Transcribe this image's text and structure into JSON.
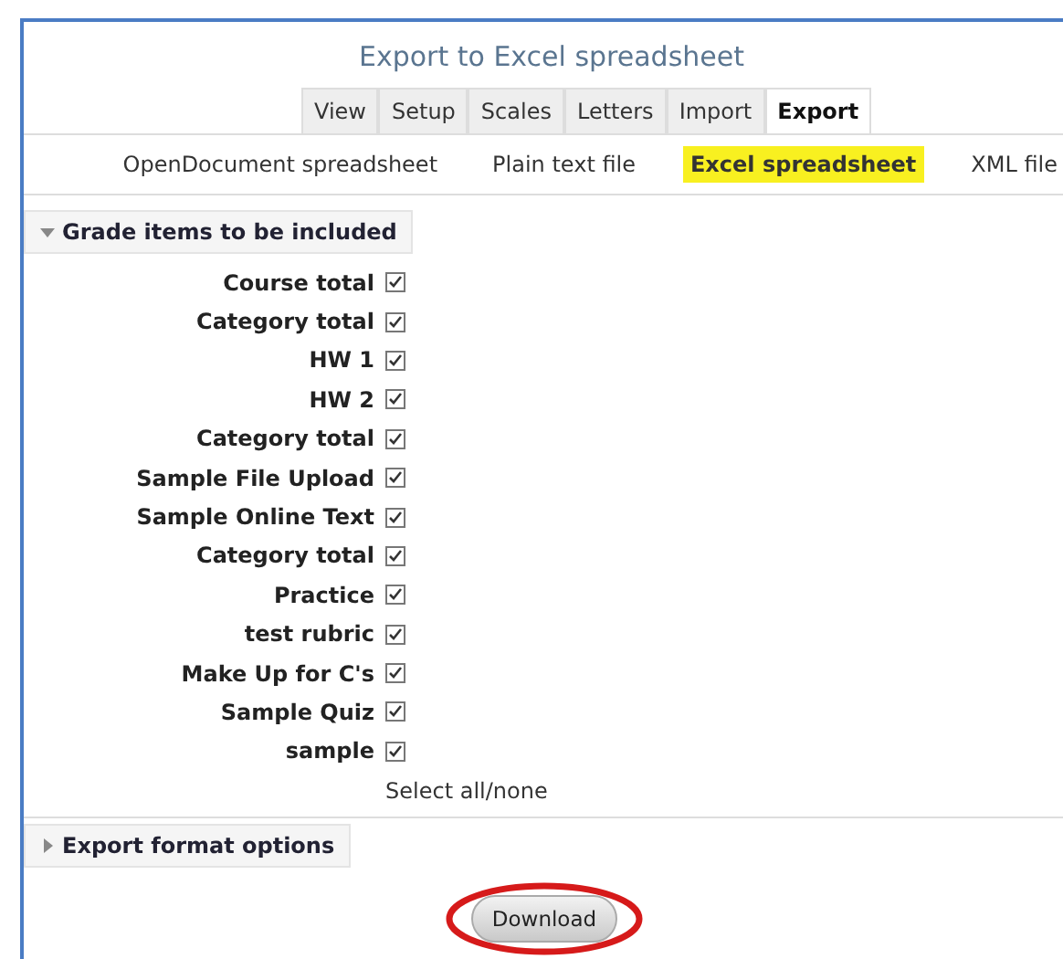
{
  "title": "Export to Excel spreadsheet",
  "tabs": [
    {
      "label": "View",
      "selected": false
    },
    {
      "label": "Setup",
      "selected": false
    },
    {
      "label": "Scales",
      "selected": false
    },
    {
      "label": "Letters",
      "selected": false
    },
    {
      "label": "Import",
      "selected": false
    },
    {
      "label": "Export",
      "selected": true
    }
  ],
  "subtabs": [
    {
      "label": "OpenDocument spreadsheet",
      "selected": false
    },
    {
      "label": "Plain text file",
      "selected": false
    },
    {
      "label": "Excel spreadsheet",
      "selected": true
    },
    {
      "label": "XML file",
      "selected": false
    }
  ],
  "grade_section": {
    "title": "Grade items to be included",
    "expanded": true,
    "items": [
      {
        "label": "Course total",
        "checked": true
      },
      {
        "label": "Category total",
        "checked": true
      },
      {
        "label": "HW 1",
        "checked": true
      },
      {
        "label": "HW 2",
        "checked": true
      },
      {
        "label": "Category total",
        "checked": true
      },
      {
        "label": "Sample File Upload",
        "checked": true
      },
      {
        "label": "Sample Online Text",
        "checked": true
      },
      {
        "label": "Category total",
        "checked": true
      },
      {
        "label": "Practice",
        "checked": true
      },
      {
        "label": "test rubric",
        "checked": true
      },
      {
        "label": "Make Up for C's",
        "checked": true
      },
      {
        "label": "Sample Quiz",
        "checked": true
      },
      {
        "label": "sample",
        "checked": true
      }
    ],
    "select_all": "Select all/none"
  },
  "format_section": {
    "title": "Export format options",
    "expanded": false
  },
  "download_button": "Download"
}
